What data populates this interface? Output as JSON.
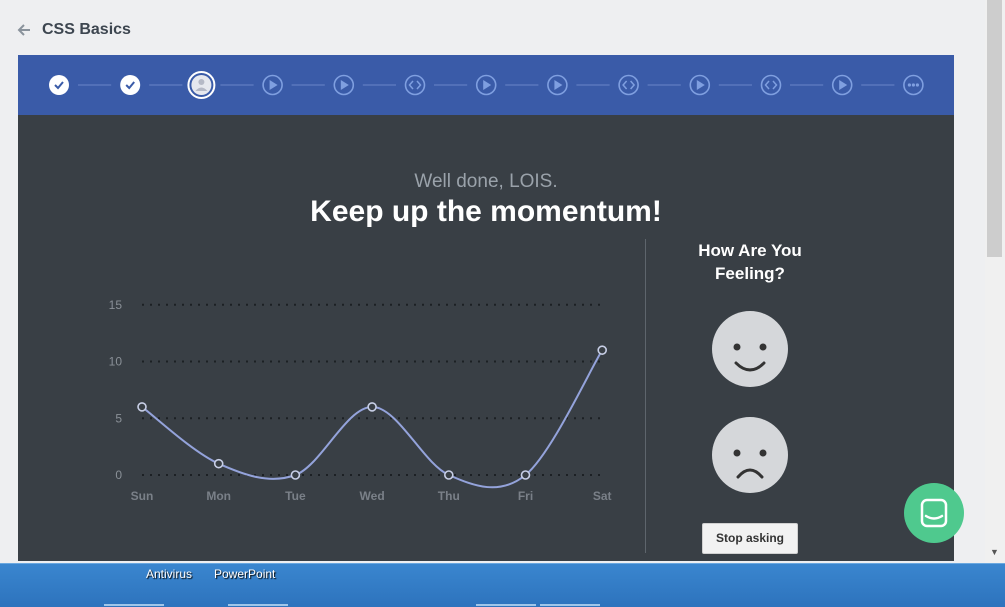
{
  "header": {
    "title": "CSS Basics"
  },
  "progress": {
    "steps": [
      {
        "type": "completed"
      },
      {
        "type": "completed"
      },
      {
        "type": "current"
      },
      {
        "type": "video"
      },
      {
        "type": "video"
      },
      {
        "type": "code"
      },
      {
        "type": "video"
      },
      {
        "type": "video"
      },
      {
        "type": "code"
      },
      {
        "type": "video"
      },
      {
        "type": "code"
      },
      {
        "type": "video"
      },
      {
        "type": "more"
      }
    ],
    "colors": {
      "bar": "#3a5ba8",
      "icon": "#7f9fe0",
      "done": "#ffffff"
    }
  },
  "main": {
    "greeting": "Well done, LOIS.",
    "headline": "Keep up the momentum!"
  },
  "chart_data": {
    "type": "line",
    "categories": [
      "Sun",
      "Mon",
      "Tue",
      "Wed",
      "Thu",
      "Fri",
      "Sat"
    ],
    "series": [
      {
        "values": [
          6,
          1,
          0,
          6,
          0,
          0,
          11
        ]
      }
    ],
    "yticks": [
      "0",
      "5",
      "10",
      "15"
    ],
    "ylim": [
      0,
      15
    ],
    "grid": true,
    "line_color": "#94a3db"
  },
  "feeling": {
    "title_line1": "How Are You",
    "title_line2": "Feeling?",
    "stop_label": "Stop asking"
  },
  "taskbar": {
    "items": [
      "Antivirus",
      "PowerPoint"
    ]
  }
}
